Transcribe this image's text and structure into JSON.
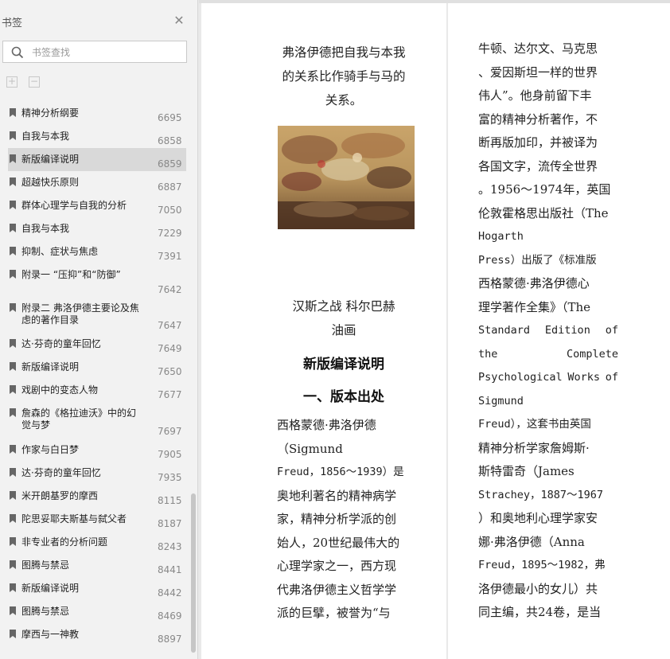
{
  "sidebar": {
    "title": "书签",
    "search_placeholder": "书签查找",
    "items": [
      {
        "label": "精神分析纲要",
        "page": "6695"
      },
      {
        "label": "自我与本我",
        "page": "6858"
      },
      {
        "label": "新版编译说明",
        "page": "6859",
        "selected": true
      },
      {
        "label": "超越快乐原则",
        "page": "6887"
      },
      {
        "label": "群体心理学与自我的分析",
        "page": "7050"
      },
      {
        "label": "自我与本我",
        "page": "7229"
      },
      {
        "label": "抑制、症状与焦虑",
        "page": "7391"
      },
      {
        "label": "附录一 “压抑”和“防御”",
        "page": "7642"
      },
      {
        "label": "附录二 弗洛伊德主要论及焦虑的著作目录",
        "page": "7647"
      },
      {
        "label": "达·芬奇的童年回忆",
        "page": "7649"
      },
      {
        "label": "新版编译说明",
        "page": "7650"
      },
      {
        "label": "戏剧中的变态人物",
        "page": "7677"
      },
      {
        "label": "詹森的《格拉迪沃》中的幻觉与梦",
        "page": "7697"
      },
      {
        "label": "作家与白日梦",
        "page": "7905"
      },
      {
        "label": "达·芬奇的童年回忆",
        "page": "7935"
      },
      {
        "label": "米开朗基罗的摩西",
        "page": "8115"
      },
      {
        "label": "陀思妥耶夫斯基与弑父者",
        "page": "8187"
      },
      {
        "label": "非专业者的分析问题",
        "page": "8243"
      },
      {
        "label": "图腾与禁忌",
        "page": "8441"
      },
      {
        "label": "新版编译说明",
        "page": "8442"
      },
      {
        "label": "图腾与禁忌",
        "page": "8469"
      },
      {
        "label": "摩西与一神教",
        "page": "8897"
      }
    ]
  },
  "page_left": {
    "caption_lines": [
      "弗洛伊德把自我与本我",
      "的关系比作骑手与马的",
      "关系。"
    ],
    "painting_caption_lines": [
      "汉斯之战  科尔巴赫",
      "油画"
    ],
    "heading1": "新版编译说明",
    "heading2": "一、版本出处",
    "body_lines": [
      "西格蒙德·弗洛伊德",
      "（Sigmund",
      "Freud，1856～1939）是",
      "奥地利著名的精神病学",
      "家，精神分析学派的创",
      "始人，20世纪最伟大的",
      "心理学家之一，西方现",
      "代弗洛伊德主义哲学学",
      "派的巨擘，被誉为“与"
    ]
  },
  "page_right": {
    "body_lines": [
      "牛顿、达尔文、马克思",
      "、爱因斯坦一样的世界",
      "伟人”。他身前留下丰",
      "富的精神分析著作，不",
      "断再版加印，并被译为",
      "各国文字，流传全世界",
      "。1956～1974年，英国",
      "伦敦霍格思出版社（The",
      "Hogarth",
      "Press）出版了《标准版",
      "西格蒙德·弗洛伊德心",
      "理学著作全集》（The",
      "Standard Edition of",
      "the Complete",
      "Psychological Works of",
      "Sigmund",
      "Freud），这套书由英国",
      "精神分析学家詹姆斯·",
      "斯特雷奇（James",
      "Strachey，1887～1967",
      "）和奥地利心理学家安",
      "娜·弗洛伊德（Anna",
      "Freud，1895～1982，弗",
      "洛伊德最小的女儿）共",
      "同主编，共24卷，是当"
    ]
  }
}
